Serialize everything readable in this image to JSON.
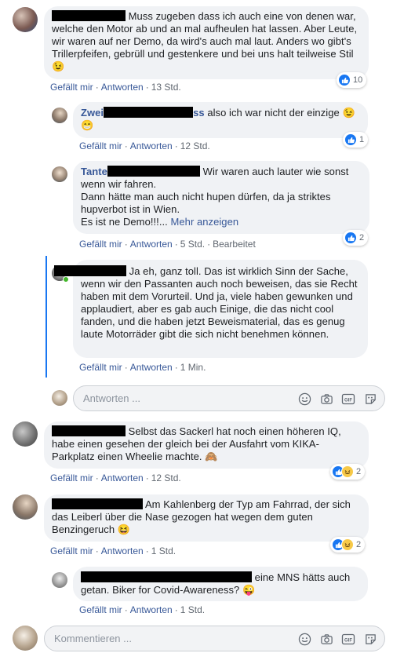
{
  "comments": [
    {
      "text": "Muss zugeben dass ich auch eine von denen war, welche den Motor ab und an mal aufheulen hat lassen. Aber Leute, wir waren auf ner Demo, da wird's auch mal laut. Anders wo gibt's Trillerpfeifen, gebrüll und gestenkere und bei uns halt teilweise Stil",
      "emoji": "😉",
      "like_label": "Gefällt mir",
      "reply_label": "Antworten",
      "time": "13 Std.",
      "reactions_count": "10",
      "replies": [
        {
          "name_prefix": "Zwei",
          "name_suffix": "ss",
          "text": "also ich war nicht der einzige",
          "emoji": "😉 😁",
          "like_label": "Gefällt mir",
          "reply_label": "Antworten",
          "time": "12 Std.",
          "reactions_count": "1"
        },
        {
          "name_prefix": "Tante",
          "text_line1": "Wir waren auch lauter wie sonst wenn wir fahren.",
          "text_line2": "Dann hätte man auch nicht hupen dürfen, da ja striktes hupverbot ist in Wien.",
          "text_line3": "Es ist ne Demo!!!...",
          "more_label": "Mehr anzeigen",
          "like_label": "Gefällt mir",
          "reply_label": "Antworten",
          "time": "5 Std.",
          "edited": "Bearbeitet",
          "reactions_count": "2"
        },
        {
          "text": "Ja eh, ganz toll. Das ist wirklich Sinn der Sache, wenn wir den Passanten auch noch beweisen, das sie Recht haben mit dem Vorurteil. Und ja, viele haben gewunken und applaudiert, aber es gab auch Einige, die das nicht cool fanden, und die haben jetzt Beweismaterial, das es genug laute Motorräder gibt die sich nicht benehmen können.",
          "like_label": "Gefällt mir",
          "reply_label": "Antworten",
          "time": "1 Min."
        }
      ],
      "reply_placeholder": "Antworten ..."
    },
    {
      "text": "Selbst das Sackerl hat noch einen höheren IQ, habe einen gesehen der gleich bei der Ausfahrt vom KIKA-Parkplatz einen Wheelie machte.",
      "emoji": "🙈",
      "like_label": "Gefällt mir",
      "reply_label": "Antworten",
      "time": "12 Std.",
      "reactions_count": "2"
    },
    {
      "text": "Am Kahlenberg der Typ am Fahrrad, der sich das Leiberl über die Nase gezogen hat wegen dem guten Benzingeruch",
      "emoji": "😆",
      "like_label": "Gefällt mir",
      "reply_label": "Antworten",
      "time": "1 Std.",
      "reactions_count": "2",
      "replies": [
        {
          "text": "eine MNS hätts auch getan. Biker for Covid-Awareness?",
          "emoji": "😜",
          "like_label": "Gefällt mir",
          "reply_label": "Antworten",
          "time": "1 Std."
        }
      ]
    }
  ],
  "comment_placeholder": "Kommentieren ...",
  "icons": {
    "emoji": "smiley-icon",
    "camera": "camera-icon",
    "gif": "gif-icon",
    "sticker": "sticker-icon",
    "like": "like-icon",
    "haha": "haha-icon"
  },
  "colors": {
    "link": "#385898",
    "like_blue": "#1877f2",
    "bubble": "#f0f2f5",
    "meta": "#606770"
  },
  "gif_label": "GIF"
}
